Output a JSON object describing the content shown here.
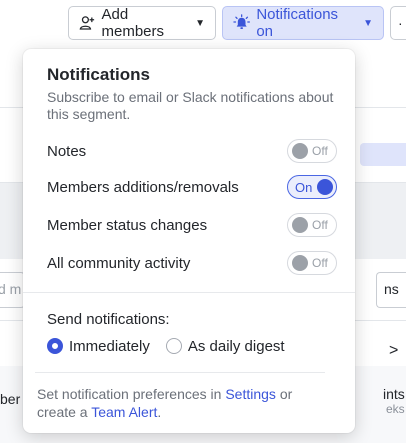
{
  "toolbar": {
    "add_members_label": "Add members",
    "notifications_label": "Notifications on",
    "accent_color": "#3b55d9"
  },
  "background": {
    "left_input_text": "d m",
    "right_input_text": "ns",
    "chevron": ">",
    "left_column_text": "ber",
    "right_column_line1": "ints",
    "right_column_line2": "eks"
  },
  "popover": {
    "title": "Notifications",
    "subtitle": "Subscribe to email or Slack notifications about this segment.",
    "toggles": [
      {
        "label": "Notes",
        "state": "Off",
        "on": false
      },
      {
        "label": "Members additions/removals",
        "state": "On",
        "on": true
      },
      {
        "label": "Member status changes",
        "state": "Off",
        "on": false
      },
      {
        "label": "All community activity",
        "state": "Off",
        "on": false
      }
    ],
    "send_label": "Send notifications:",
    "radio_options": [
      {
        "label": "Immediately",
        "selected": true
      },
      {
        "label": "As daily digest",
        "selected": false
      }
    ],
    "footer": {
      "prefix": "Set notification preferences in ",
      "settings_link": "Settings",
      "middle": " or create a ",
      "team_alert_link": "Team Alert",
      "suffix": "."
    }
  }
}
